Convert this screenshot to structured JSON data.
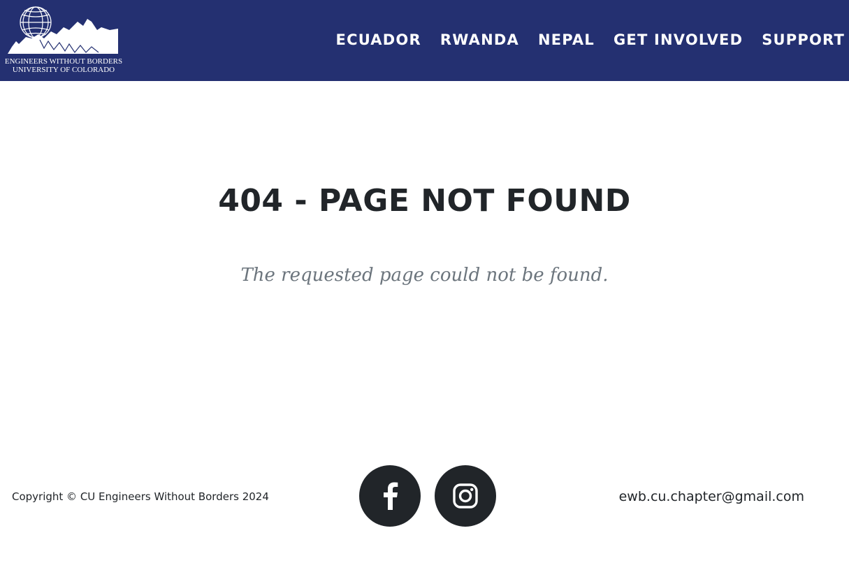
{
  "brand": {
    "line1": "ENGINEERS WITHOUT BORDERS",
    "line2": "UNIVERSITY OF COLORADO",
    "icon": "globe-mountains-logo"
  },
  "nav": {
    "links": [
      {
        "label": "ECUADOR"
      },
      {
        "label": "RWANDA"
      },
      {
        "label": "NEPAL"
      },
      {
        "label": "GET INVOLVED"
      },
      {
        "label": "SUPPORT"
      }
    ]
  },
  "main": {
    "title": "404 - PAGE NOT FOUND",
    "subtitle": "The requested page could not be found."
  },
  "footer": {
    "copyright": "Copyright © CU Engineers Without Borders 2024",
    "email": "ewb.cu.chapter@gmail.com",
    "social": [
      {
        "icon": "facebook-icon"
      },
      {
        "icon": "instagram-icon"
      }
    ]
  },
  "colors": {
    "navbar_bg": "#243071",
    "text_dark": "#212529",
    "text_muted": "#6c757d",
    "social_bg": "#212529"
  }
}
